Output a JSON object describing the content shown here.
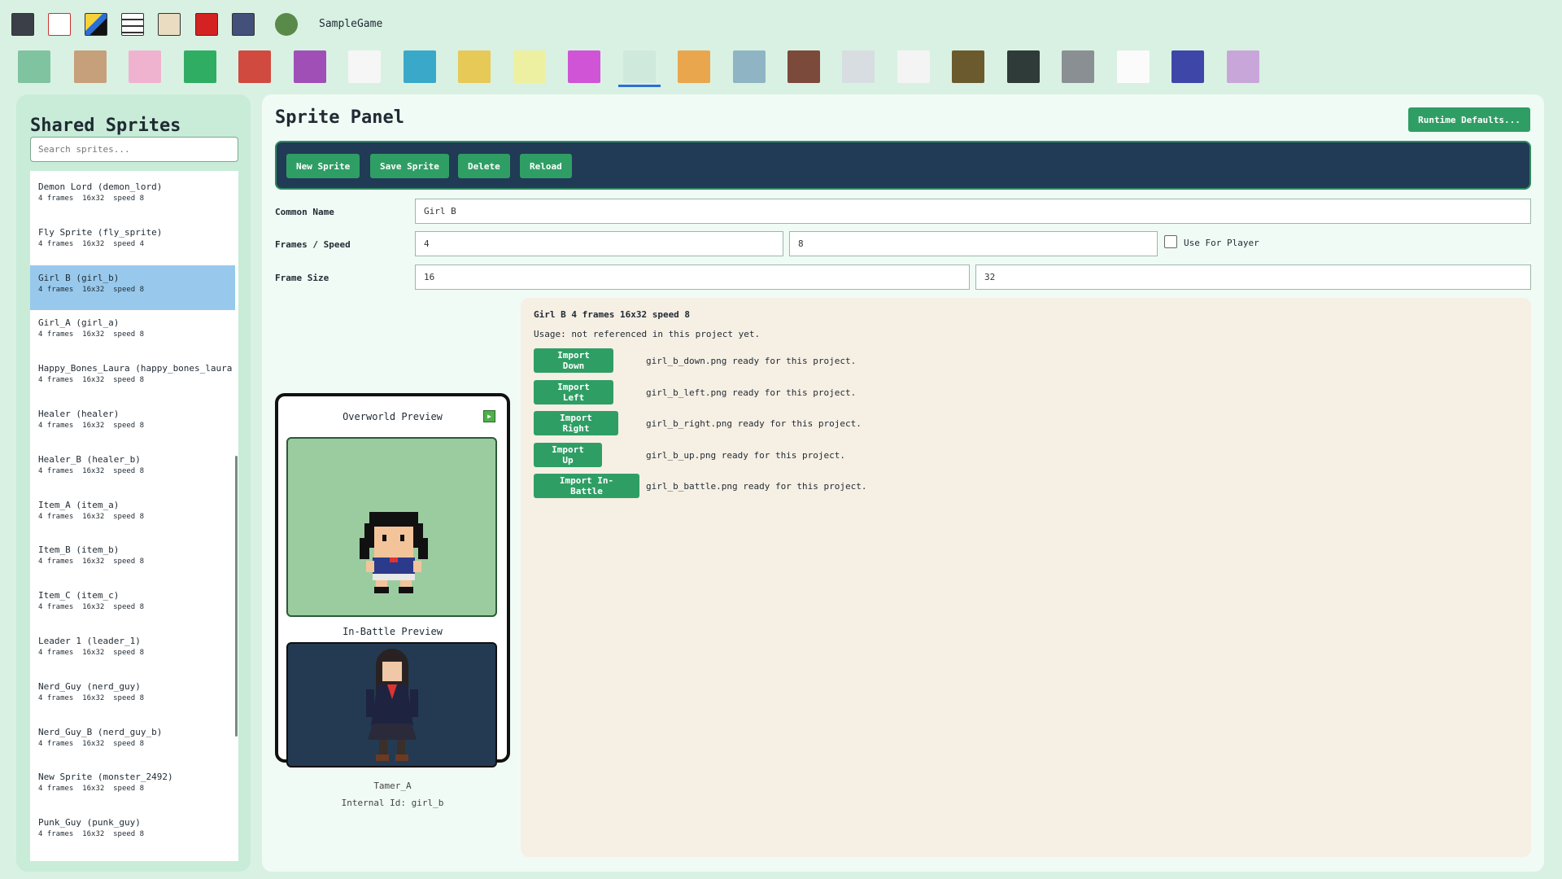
{
  "app": {
    "game_name": "SampleGame"
  },
  "top_icons": [
    "save-icon",
    "exit-icon",
    "pencil-icon",
    "list-icon",
    "scroll-icon",
    "gem-icon",
    "grid-icon",
    "frog-icon"
  ],
  "toolbar": [
    {
      "name": "map-icon",
      "color": "#7fc3a0"
    },
    {
      "name": "portrait-icon",
      "color": "#c6a07a"
    },
    {
      "name": "egg-icon",
      "color": "#efb3cf"
    },
    {
      "name": "play-icon",
      "color": "#2fae63"
    },
    {
      "name": "versus-icon",
      "color": "#d04a40"
    },
    {
      "name": "fire-icon",
      "color": "#a04fb7"
    },
    {
      "name": "runner-icon",
      "color": "#f6f6f6"
    },
    {
      "name": "ability-icon",
      "color": "#3aa9c9"
    },
    {
      "name": "fruit-icon",
      "color": "#e7c958"
    },
    {
      "name": "potion-icon",
      "color": "#eef0a1"
    },
    {
      "name": "creature-icon",
      "color": "#cf54d6"
    },
    {
      "name": "characters-icon",
      "color": "#cfe9dc"
    },
    {
      "name": "tools-icon",
      "color": "#e9a64c"
    },
    {
      "name": "monster-icon",
      "color": "#8fb5c4"
    },
    {
      "name": "room-icon",
      "color": "#7c4a3a"
    },
    {
      "name": "document-icon",
      "color": "#d7dde0"
    },
    {
      "name": "music-icon",
      "color": "#f4f4f4"
    },
    {
      "name": "portrait-art-icon",
      "color": "#6b5a2e"
    },
    {
      "name": "variables-icon",
      "color": "#2e3b38"
    },
    {
      "name": "window-icon",
      "color": "#8a8f93"
    },
    {
      "name": "text-icon",
      "color": "#fbfbfb"
    },
    {
      "name": "tiles-icon",
      "color": "#3e46a7"
    },
    {
      "name": "pacifier-icon",
      "color": "#c9a6d9"
    }
  ],
  "sidebar": {
    "title": "Shared Sprites",
    "search_placeholder": "Search sprites...",
    "items": [
      {
        "name": "Demon Lord (demon_lord)",
        "meta": "4 frames  16x32  speed 8"
      },
      {
        "name": "Fly Sprite (fly_sprite)",
        "meta": "4 frames  16x32  speed 4"
      },
      {
        "name": "Girl B (girl_b)",
        "meta": "4 frames  16x32  speed 8"
      },
      {
        "name": "Girl_A (girl_a)",
        "meta": "4 frames  16x32  speed 8"
      },
      {
        "name": "Happy_Bones_Laura (happy_bones_laura",
        "meta": "4 frames  16x32  speed 8"
      },
      {
        "name": "Healer (healer)",
        "meta": "4 frames  16x32  speed 8"
      },
      {
        "name": "Healer_B (healer_b)",
        "meta": "4 frames  16x32  speed 8"
      },
      {
        "name": "Item_A (item_a)",
        "meta": "4 frames  16x32  speed 8"
      },
      {
        "name": "Item_B (item_b)",
        "meta": "4 frames  16x32  speed 8"
      },
      {
        "name": "Item_C (item_c)",
        "meta": "4 frames  16x32  speed 8"
      },
      {
        "name": "Leader 1 (leader_1)",
        "meta": "4 frames  16x32  speed 8"
      },
      {
        "name": "Nerd_Guy (nerd_guy)",
        "meta": "4 frames  16x32  speed 8"
      },
      {
        "name": "Nerd_Guy_B (nerd_guy_b)",
        "meta": "4 frames  16x32  speed 8"
      },
      {
        "name": "New Sprite (monster_2492)",
        "meta": "4 frames  16x32  speed 8"
      },
      {
        "name": "Punk_Guy (punk_guy)",
        "meta": "4 frames  16x32  speed 8"
      }
    ]
  },
  "panel": {
    "title": "Sprite Panel",
    "runtime_defaults": "Runtime Defaults...",
    "actions": {
      "new": "New Sprite",
      "save": "Save Sprite",
      "delete": "Delete",
      "reload": "Reload"
    },
    "labels": {
      "common_name": "Common Name",
      "frames_speed": "Frames / Speed",
      "frame_size": "Frame Size",
      "use_for_player": "Use For Player"
    },
    "values": {
      "common_name": "Girl B",
      "frames": "4",
      "speed": "8",
      "width": "16",
      "height": "32"
    },
    "preview": {
      "overworld": "Overworld Preview",
      "battle": "In-Battle Preview",
      "tamer": "Tamer_A",
      "internal_id": "Internal Id: girl_b"
    },
    "info": {
      "summary": "Girl B  4 frames  16x32  speed 8",
      "usage": "Usage: not referenced in this project yet.",
      "imports": [
        {
          "label": "Import Down",
          "status": "girl_b_down.png ready for this project."
        },
        {
          "label": "Import Left",
          "status": "girl_b_left.png ready for this project."
        },
        {
          "label": "Import Right",
          "status": "girl_b_right.png ready for this project."
        },
        {
          "label": "Import Up",
          "status": "girl_b_up.png ready for this project."
        },
        {
          "label": "Import In-Battle",
          "status": "girl_b_battle.png ready for this project."
        }
      ]
    }
  }
}
